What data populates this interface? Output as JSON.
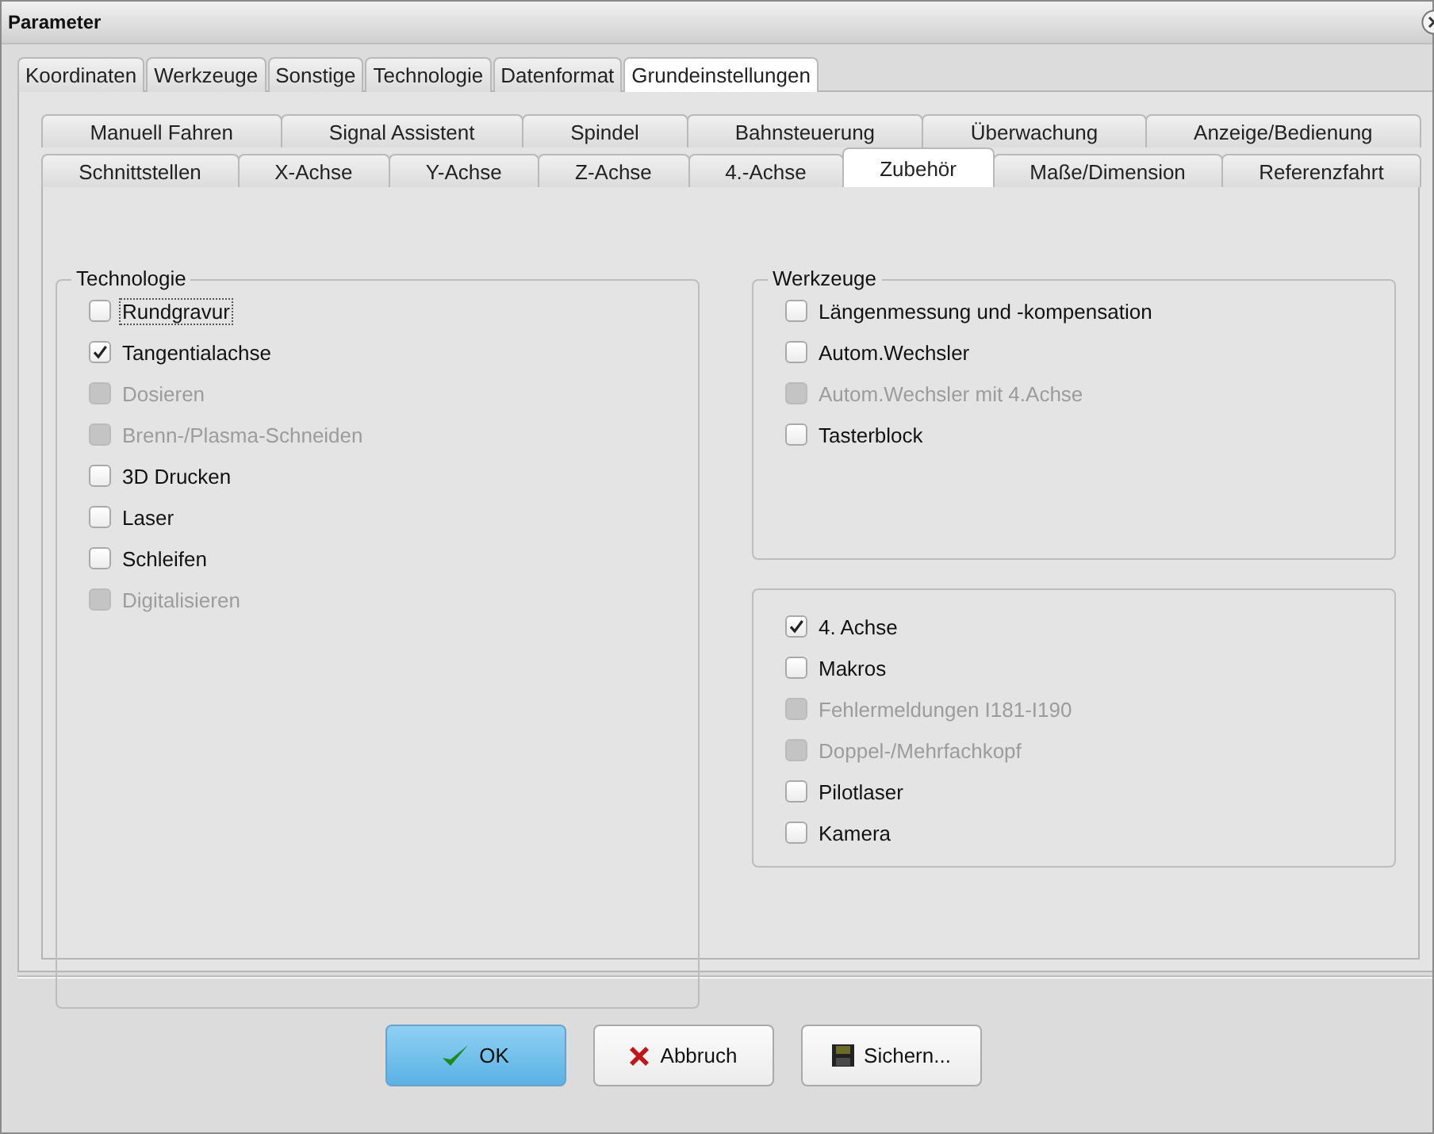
{
  "window": {
    "title": "Parameter"
  },
  "tabs": [
    {
      "label": "Koordinaten",
      "selected": false
    },
    {
      "label": "Werkzeuge",
      "selected": false
    },
    {
      "label": "Sonstige",
      "selected": false
    },
    {
      "label": "Technologie",
      "selected": false
    },
    {
      "label": "Datenformat",
      "selected": false
    },
    {
      "label": "Grundeinstellungen",
      "selected": true
    }
  ],
  "sub_tabs": [
    [
      {
        "label": "Manuell Fahren",
        "selected": false
      },
      {
        "label": "Signal Assistent",
        "selected": false
      },
      {
        "label": "Spindel",
        "selected": false
      },
      {
        "label": "Bahnsteuerung",
        "selected": false
      },
      {
        "label": "Überwachung",
        "selected": false
      },
      {
        "label": "Anzeige/Bedienung",
        "selected": false
      }
    ],
    [
      {
        "label": "Schnittstellen",
        "selected": false
      },
      {
        "label": "X-Achse",
        "selected": false
      },
      {
        "label": "Y-Achse",
        "selected": false
      },
      {
        "label": "Z-Achse",
        "selected": false
      },
      {
        "label": "4.-Achse",
        "selected": false
      },
      {
        "label": "Zubehör",
        "selected": true
      },
      {
        "label": "Maße/Dimension",
        "selected": false
      },
      {
        "label": "Referenzfahrt",
        "selected": false
      }
    ]
  ],
  "groups": [
    {
      "title": "Technologie",
      "items": [
        {
          "label": "Rundgravur",
          "checked": false,
          "disabled": false,
          "focused": true
        },
        {
          "label": "Tangentialachse",
          "checked": true,
          "disabled": false,
          "focused": false
        },
        {
          "label": "Dosieren",
          "checked": false,
          "disabled": true,
          "focused": false
        },
        {
          "label": "Brenn-/Plasma-Schneiden",
          "checked": false,
          "disabled": true,
          "focused": false
        },
        {
          "label": "3D Drucken",
          "checked": false,
          "disabled": false,
          "focused": false
        },
        {
          "label": "Laser",
          "checked": false,
          "disabled": false,
          "focused": false
        },
        {
          "label": "Schleifen",
          "checked": false,
          "disabled": false,
          "focused": false
        },
        {
          "label": "Digitalisieren",
          "checked": false,
          "disabled": true,
          "focused": false
        }
      ]
    },
    {
      "title": "Werkzeuge",
      "items": [
        {
          "label": "Längenmessung und -kompensation",
          "checked": false,
          "disabled": false,
          "focused": false
        },
        {
          "label": "Autom.Wechsler",
          "checked": false,
          "disabled": false,
          "focused": false
        },
        {
          "label": "Autom.Wechsler mit 4.Achse",
          "checked": false,
          "disabled": true,
          "focused": false
        },
        {
          "label": "Tasterblock",
          "checked": false,
          "disabled": false,
          "focused": false
        }
      ]
    },
    {
      "items": [
        {
          "label": "4. Achse",
          "checked": true,
          "disabled": false,
          "focused": false
        },
        {
          "label": "Makros",
          "checked": false,
          "disabled": false,
          "focused": false
        },
        {
          "label": "Fehlermeldungen I181-I190",
          "checked": false,
          "disabled": true,
          "focused": false
        },
        {
          "label": "Doppel-/Mehrfachkopf",
          "checked": false,
          "disabled": true,
          "focused": false
        },
        {
          "label": "Pilotlaser",
          "checked": false,
          "disabled": false,
          "focused": false
        },
        {
          "label": "Kamera",
          "checked": false,
          "disabled": false,
          "focused": false
        }
      ]
    }
  ],
  "buttons": [
    {
      "label": "OK",
      "kind": "check",
      "default": true
    },
    {
      "label": "Abbruch",
      "kind": "cancel",
      "default": false
    },
    {
      "label": "Sichern...",
      "kind": "save",
      "default": false
    }
  ]
}
